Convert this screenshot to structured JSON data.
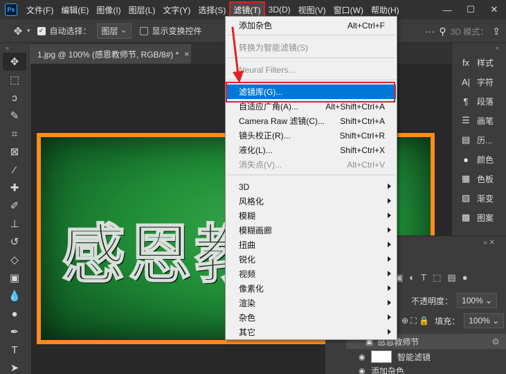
{
  "app": {
    "logo": "Ps"
  },
  "menubar": {
    "items": [
      "文件(F)",
      "编辑(E)",
      "图像(I)",
      "图层(L)",
      "文字(Y)",
      "选择(S)",
      "滤镜(T)",
      "3D(D)",
      "视图(V)",
      "窗口(W)",
      "帮助(H)"
    ],
    "active_index": 6
  },
  "window_controls": {
    "minimize": "—",
    "maximize": "☐",
    "close": "✕"
  },
  "options": {
    "auto_select_label": "自动选择：",
    "auto_select_checked": true,
    "target_value": "图层",
    "show_transform_label": "显示变换控件",
    "show_transform_checked": false,
    "mode_3d_label": "3D 模式："
  },
  "document": {
    "tab_title": "1.jpg @ 100% (感恩教师节, RGB/8#) *",
    "close_glyph": "×",
    "canvas_text": "感恩教师节"
  },
  "filter_menu": {
    "items": [
      {
        "label": "添加杂色",
        "shortcut": "Alt+Ctrl+F",
        "enabled": true
      },
      {
        "label": "转换为智能滤镜(S)",
        "shortcut": "",
        "enabled": false
      },
      {
        "label": "Neural Filters...",
        "shortcut": "",
        "enabled": false
      },
      {
        "label": "滤镜库(G)...",
        "shortcut": "",
        "enabled": true,
        "highlighted": true
      },
      {
        "label": "自适应广角(A)...",
        "shortcut": "Alt+Shift+Ctrl+A",
        "enabled": true
      },
      {
        "label": "Camera Raw 滤镜(C)...",
        "shortcut": "Shift+Ctrl+A",
        "enabled": true
      },
      {
        "label": "镜头校正(R)...",
        "shortcut": "Shift+Ctrl+R",
        "enabled": true
      },
      {
        "label": "液化(L)...",
        "shortcut": "Shift+Ctrl+X",
        "enabled": true
      },
      {
        "label": "消失点(V)...",
        "shortcut": "Alt+Ctrl+V",
        "enabled": false
      }
    ],
    "submenus": [
      "3D",
      "风格化",
      "模糊",
      "模糊画廊",
      "扭曲",
      "锐化",
      "视频",
      "像素化",
      "渲染",
      "杂色",
      "其它"
    ]
  },
  "right_panels": {
    "items": [
      {
        "icon": "fx",
        "label": "样式"
      },
      {
        "icon": "A|",
        "label": "字符"
      },
      {
        "icon": "¶",
        "label": "段落"
      },
      {
        "icon": "☰",
        "label": "画笔"
      },
      {
        "icon": "▤",
        "label": "历..."
      },
      {
        "icon": "●",
        "label": "颜色"
      },
      {
        "icon": "▦",
        "label": "色板"
      },
      {
        "icon": "▨",
        "label": "渐变"
      },
      {
        "icon": "▩",
        "label": "图案"
      }
    ]
  },
  "layers": {
    "opacity_label": "不透明度：",
    "opacity_value": "100%",
    "fill_label": "填充：",
    "fill_value": "100%",
    "layer_name": "感恩教师节",
    "smart_filter_label": "智能滤镜",
    "filter_entry": "添加杂色"
  }
}
